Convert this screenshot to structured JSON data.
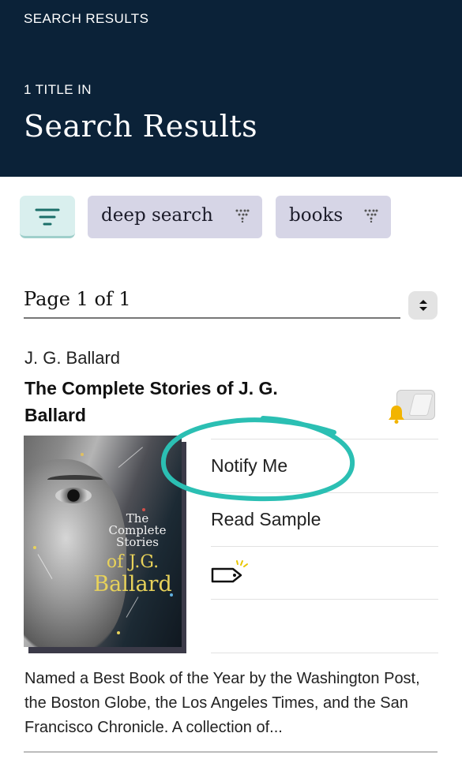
{
  "header": {
    "breadcrumb": "SEARCH RESULTS",
    "count_label": "1 TITLE IN",
    "title": "Search Results",
    "background": "#0b2238"
  },
  "filters": {
    "filter_icon": "filter-lines-icon",
    "chips": [
      {
        "label": "deep search",
        "icon": "funnel-dots-icon"
      },
      {
        "label": "books",
        "icon": "funnel-dots-icon"
      }
    ]
  },
  "pager": {
    "label": "Page 1 of 1",
    "icon": "sort-up-down-icon"
  },
  "result": {
    "author": "J. G. Ballard",
    "title": "The Complete Stories of J. G. Ballard",
    "wishlist_icon": "bell-icon",
    "cover": {
      "line1": "The",
      "line2": "Complete",
      "line3": "Stories",
      "line4": "of J.G.",
      "name": "Ballard"
    },
    "actions": {
      "notify": "Notify Me",
      "sample": "Read Sample",
      "tag_icon": "tag-icon"
    },
    "description": "Named a Best Book of the Year by the Washington Post, the Boston Globe, the Los Angeles Times, and the San Francisco Chronicle. A collection of..."
  },
  "colors": {
    "accent_teal": "#2bbfb3",
    "chip_bg": "#d6d5e6",
    "filter_bg": "#d9efee",
    "cover_gold": "#e8d25a"
  }
}
